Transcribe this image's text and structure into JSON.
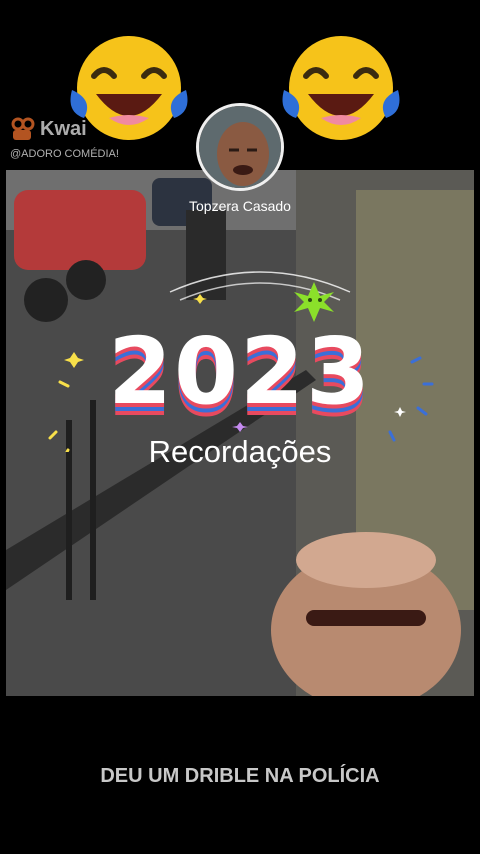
{
  "watermark": {
    "brand": "Kwai",
    "handle": "@ADORO COMÉDIA!"
  },
  "creator": {
    "name": "Topzera  Casado"
  },
  "overlay": {
    "year": "2023",
    "subtitle": "Recordações"
  },
  "caption": {
    "text": "DEU UM DRIBLE NA POLÍCIA"
  },
  "colors": {
    "accent_red": "#e84a5f",
    "accent_blue": "#3b6fd8",
    "emoji_yellow": "#f6c31a",
    "tear_blue": "#2f6fd8"
  },
  "icons": {
    "left_emoji": "laughing-tears-icon",
    "right_emoji": "laughing-tears-icon",
    "brand_mark": "kwai-logo-icon"
  }
}
